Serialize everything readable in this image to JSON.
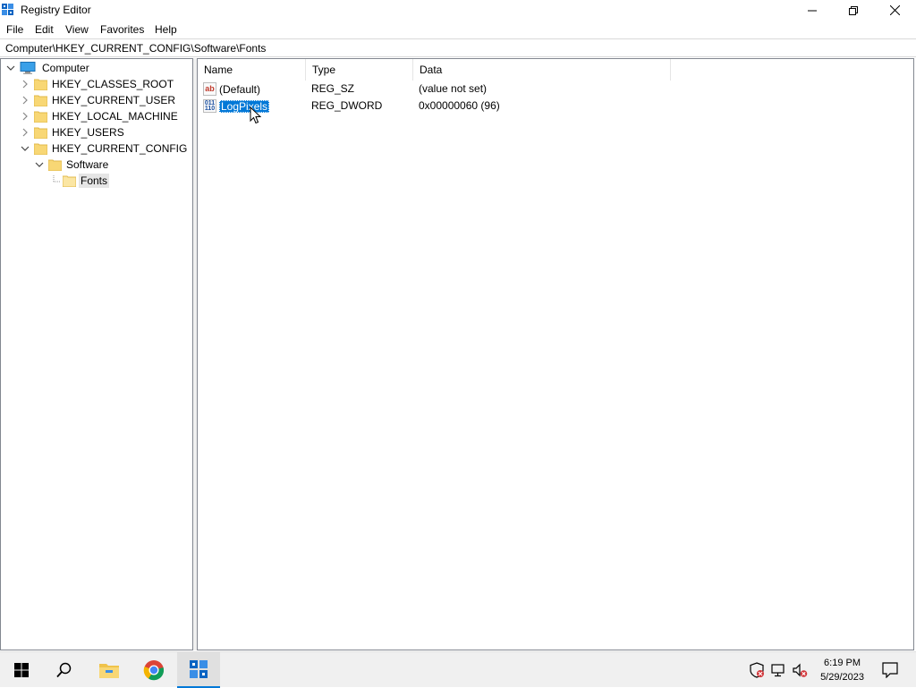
{
  "window": {
    "title": "Registry Editor",
    "app_icon": "regedit-icon",
    "controls": [
      "minimize-icon",
      "restore-icon",
      "close-icon"
    ]
  },
  "menubar": {
    "items": [
      {
        "label": "File"
      },
      {
        "label": "Edit"
      },
      {
        "label": "View"
      },
      {
        "label": "Favorites"
      },
      {
        "label": "Help"
      }
    ]
  },
  "address": {
    "path": "Computer\\HKEY_CURRENT_CONFIG\\Software\\Fonts"
  },
  "tree": {
    "items": [
      {
        "label": "Computer",
        "level": 0,
        "expanded": true,
        "icon": "computer-icon"
      },
      {
        "label": "HKEY_CLASSES_ROOT",
        "level": 1,
        "expanded": false,
        "icon": "folder-icon"
      },
      {
        "label": "HKEY_CURRENT_USER",
        "level": 1,
        "expanded": false,
        "icon": "folder-icon"
      },
      {
        "label": "HKEY_LOCAL_MACHINE",
        "level": 1,
        "expanded": false,
        "icon": "folder-icon"
      },
      {
        "label": "HKEY_USERS",
        "level": 1,
        "expanded": false,
        "icon": "folder-icon"
      },
      {
        "label": "HKEY_CURRENT_CONFIG",
        "level": 1,
        "expanded": true,
        "icon": "folder-icon"
      },
      {
        "label": "Software",
        "level": 2,
        "expanded": true,
        "icon": "folder-icon"
      },
      {
        "label": "Fonts",
        "level": 3,
        "expanded": false,
        "icon": "folder-icon",
        "selected": true
      }
    ]
  },
  "list": {
    "columns": [
      "Name",
      "Type",
      "Data"
    ],
    "rows": [
      {
        "name": "(Default)",
        "type": "REG_SZ",
        "data": "(value not set)",
        "icon": "string-value-icon",
        "icon_text": "ab"
      },
      {
        "name": "LogPixels",
        "type": "REG_DWORD",
        "data": "0x00000060 (96)",
        "icon": "binary-value-icon",
        "icon_text": "011\n110",
        "selected": true
      }
    ]
  },
  "taskbar": {
    "apps": [
      "start-icon",
      "search-icon",
      "file-explorer-icon",
      "chrome-icon",
      "regedit-icon"
    ],
    "active_app": "regedit-icon",
    "tray": [
      "security-icon",
      "network-icon",
      "volume-muted-icon"
    ],
    "time": "6:19 PM",
    "date": "5/29/2023",
    "notification_icon": "notification-icon"
  },
  "colors": {
    "selection": "#0078d7",
    "folder": "#f8d775",
    "taskbar": "#f0f0f0"
  }
}
